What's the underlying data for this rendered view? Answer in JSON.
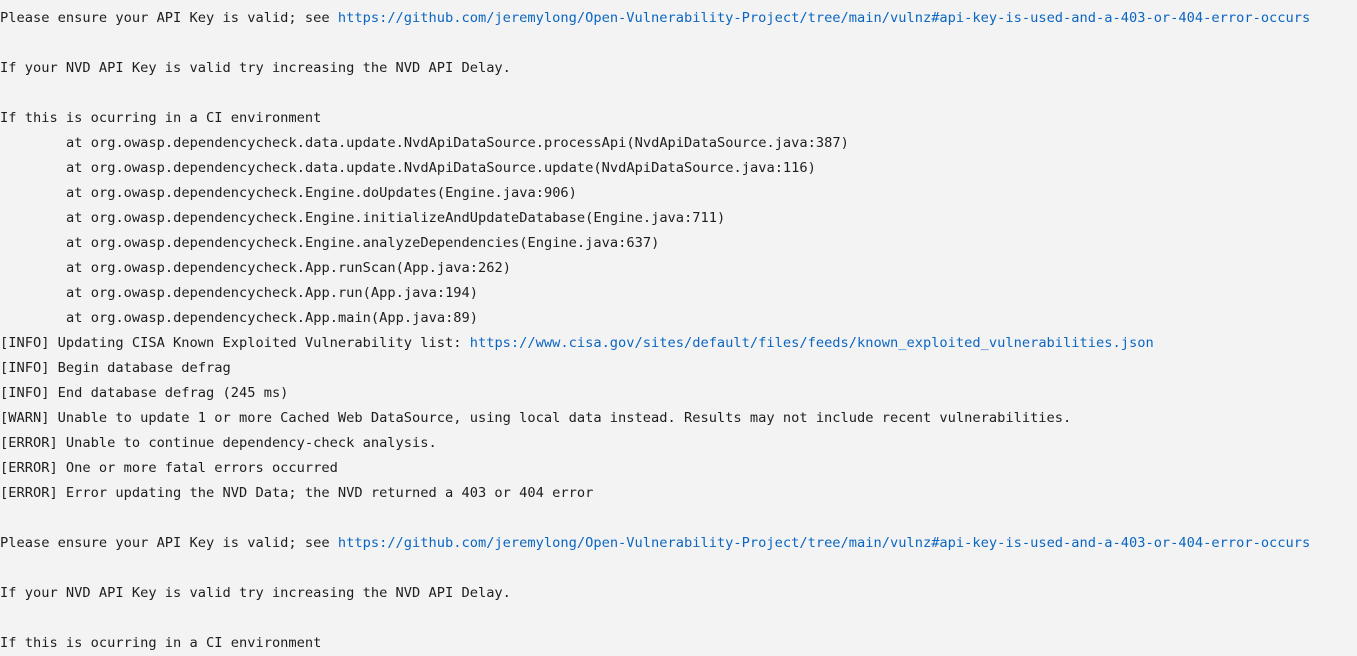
{
  "lines": [
    {
      "kind": "link",
      "text": "Please ensure your API Key is valid; see ",
      "url": "https://github.com/jeremylong/Open-Vulnerability-Project/tree/main/vulnz#api-key-is-used-and-a-403-or-404-error-occurs"
    },
    {
      "kind": "blank"
    },
    {
      "kind": "text",
      "text": "If your NVD API Key is valid try increasing the NVD API Delay."
    },
    {
      "kind": "blank"
    },
    {
      "kind": "text",
      "text": "If this is ocurring in a CI environment"
    },
    {
      "kind": "stack",
      "text": "at org.owasp.dependencycheck.data.update.NvdApiDataSource.processApi(NvdApiDataSource.java:387)"
    },
    {
      "kind": "stack",
      "text": "at org.owasp.dependencycheck.data.update.NvdApiDataSource.update(NvdApiDataSource.java:116)"
    },
    {
      "kind": "stack",
      "text": "at org.owasp.dependencycheck.Engine.doUpdates(Engine.java:906)"
    },
    {
      "kind": "stack",
      "text": "at org.owasp.dependencycheck.Engine.initializeAndUpdateDatabase(Engine.java:711)"
    },
    {
      "kind": "stack",
      "text": "at org.owasp.dependencycheck.Engine.analyzeDependencies(Engine.java:637)"
    },
    {
      "kind": "stack",
      "text": "at org.owasp.dependencycheck.App.runScan(App.java:262)"
    },
    {
      "kind": "stack",
      "text": "at org.owasp.dependencycheck.App.run(App.java:194)"
    },
    {
      "kind": "stack",
      "text": "at org.owasp.dependencycheck.App.main(App.java:89)"
    },
    {
      "kind": "link",
      "text": "[INFO] Updating CISA Known Exploited Vulnerability list: ",
      "url": "https://www.cisa.gov/sites/default/files/feeds/known_exploited_vulnerabilities.json"
    },
    {
      "kind": "text",
      "text": "[INFO] Begin database defrag"
    },
    {
      "kind": "text",
      "text": "[INFO] End database defrag (245 ms)"
    },
    {
      "kind": "text",
      "text": "[WARN] Unable to update 1 or more Cached Web DataSource, using local data instead. Results may not include recent vulnerabilities."
    },
    {
      "kind": "text",
      "text": "[ERROR] Unable to continue dependency-check analysis."
    },
    {
      "kind": "text",
      "text": "[ERROR] One or more fatal errors occurred"
    },
    {
      "kind": "text",
      "text": "[ERROR] Error updating the NVD Data; the NVD returned a 403 or 404 error"
    },
    {
      "kind": "blank"
    },
    {
      "kind": "link",
      "text": "Please ensure your API Key is valid; see ",
      "url": "https://github.com/jeremylong/Open-Vulnerability-Project/tree/main/vulnz#api-key-is-used-and-a-403-or-404-error-occurs"
    },
    {
      "kind": "blank"
    },
    {
      "kind": "text",
      "text": "If your NVD API Key is valid try increasing the NVD API Delay."
    },
    {
      "kind": "blank"
    },
    {
      "kind": "text",
      "text": "If this is ocurring in a CI environment"
    }
  ],
  "colors": {
    "background": "#f3f3f3",
    "text": "#1e1e1e",
    "link": "#0b66c2"
  }
}
